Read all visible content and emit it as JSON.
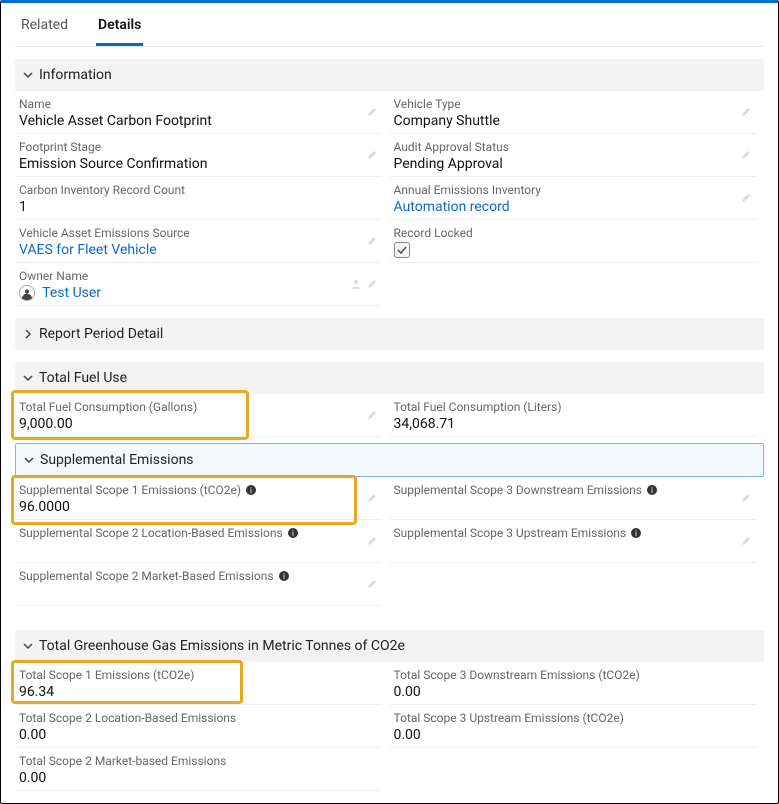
{
  "tabs": {
    "related": "Related",
    "details": "Details",
    "active": "details"
  },
  "sections": {
    "information": "Information",
    "reportPeriod": "Report Period Detail",
    "totalFuel": "Total Fuel Use",
    "supplemental": "Supplemental Emissions",
    "ghg": "Total Greenhouse Gas Emissions in Metric Tonnes of CO2e"
  },
  "info": {
    "left": {
      "name_label": "Name",
      "name": "Vehicle Asset Carbon Footprint",
      "stage_label": "Footprint Stage",
      "stage": "Emission Source Confirmation",
      "count_label": "Carbon Inventory Record Count",
      "count": "1",
      "source_label": "Vehicle Asset Emissions Source",
      "source": "VAES for Fleet Vehicle",
      "owner_label": "Owner Name",
      "owner": "Test User"
    },
    "right": {
      "vtype_label": "Vehicle Type",
      "vtype": "Company Shuttle",
      "audit_label": "Audit Approval Status",
      "audit": "Pending Approval",
      "annual_label": "Annual Emissions Inventory",
      "annual": "Automation record",
      "locked_label": "Record Locked",
      "locked": true
    }
  },
  "fuel": {
    "gal_label": "Total Fuel Consumption (Gallons)",
    "gal": "9,000.00",
    "lit_label": "Total Fuel Consumption (Liters)",
    "lit": "34,068.71"
  },
  "supp": {
    "s1_label": "Supplemental Scope 1 Emissions (tCO2e)",
    "s1": "96.0000",
    "s2loc_label": "Supplemental Scope 2 Location-Based Emissions",
    "s2mkt_label": "Supplemental Scope 2 Market-Based Emissions",
    "s3down_label": "Supplemental Scope 3 Downstream Emissions",
    "s3up_label": "Supplemental Scope 3 Upstream Emissions"
  },
  "ghg": {
    "s1_label": "Total Scope 1 Emissions (tCO2e)",
    "s1": "96.34",
    "s2loc_label": "Total Scope 2 Location-Based Emissions",
    "s2loc": "0.00",
    "s2mkt_label": "Total Scope 2 Market-based Emissions",
    "s2mkt": "0.00",
    "s3down_label": "Total Scope 3 Downstream Emissions (tCO2e)",
    "s3down": "0.00",
    "s3up_label": "Total Scope 3 Upstream Emissions (tCO2e)",
    "s3up": "0.00"
  }
}
